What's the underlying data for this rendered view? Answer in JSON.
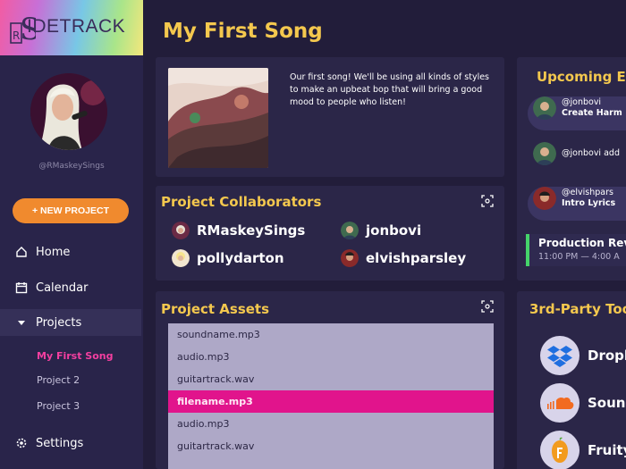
{
  "app": {
    "logo_text": "IDETRACK",
    "logo_letter": "S"
  },
  "profile": {
    "handle": "@RMaskeySings"
  },
  "sidebar": {
    "new_project_label": "+ NEW PROJECT",
    "nav": [
      {
        "label": "Home",
        "icon": "home-icon"
      },
      {
        "label": "Calendar",
        "icon": "calendar-icon"
      },
      {
        "label": "Projects",
        "icon": "caret-down-icon"
      },
      {
        "label": "Settings",
        "icon": "gear-icon"
      }
    ],
    "projects": [
      "My First Song",
      "Project 2",
      "Project 3"
    ]
  },
  "page": {
    "title": "My First Song"
  },
  "overview": {
    "description": "Our first song! We'll be using all kinds of styles to make an upbeat bop that will bring a good mood to people who listen!"
  },
  "collaborators": {
    "title": "Project Collaborators",
    "people": [
      "RMaskeySings",
      "jonbovi",
      "pollydarton",
      "elvishparsley"
    ]
  },
  "assets": {
    "title": "Project Assets",
    "files": [
      "soundname.mp3",
      "audio.mp3",
      "guitartrack.wav",
      "filename.mp3",
      "audio.mp3",
      "guitartrack.wav"
    ],
    "selected_index": 3
  },
  "events": {
    "title": "Upcoming Ev",
    "items": [
      {
        "line1": "@jonbovi",
        "line2": "Create Harm"
      },
      {
        "line1": "@jonbovi add",
        "line2": ""
      },
      {
        "line1": "@elvishpars",
        "line2": "Intro Lyrics"
      }
    ],
    "production": {
      "title": "Production Rev",
      "time": "11:00 PM — 4:00 A"
    }
  },
  "tools": {
    "title": "3rd-Party Too",
    "items": [
      "Dropb",
      "Sound",
      "Fruity"
    ]
  },
  "colors": {
    "accent_yellow": "#f4c84e",
    "accent_pink": "#e1148c",
    "button_orange": "#f08a2e",
    "bg": "#221d3a",
    "card": "#2b2648"
  }
}
